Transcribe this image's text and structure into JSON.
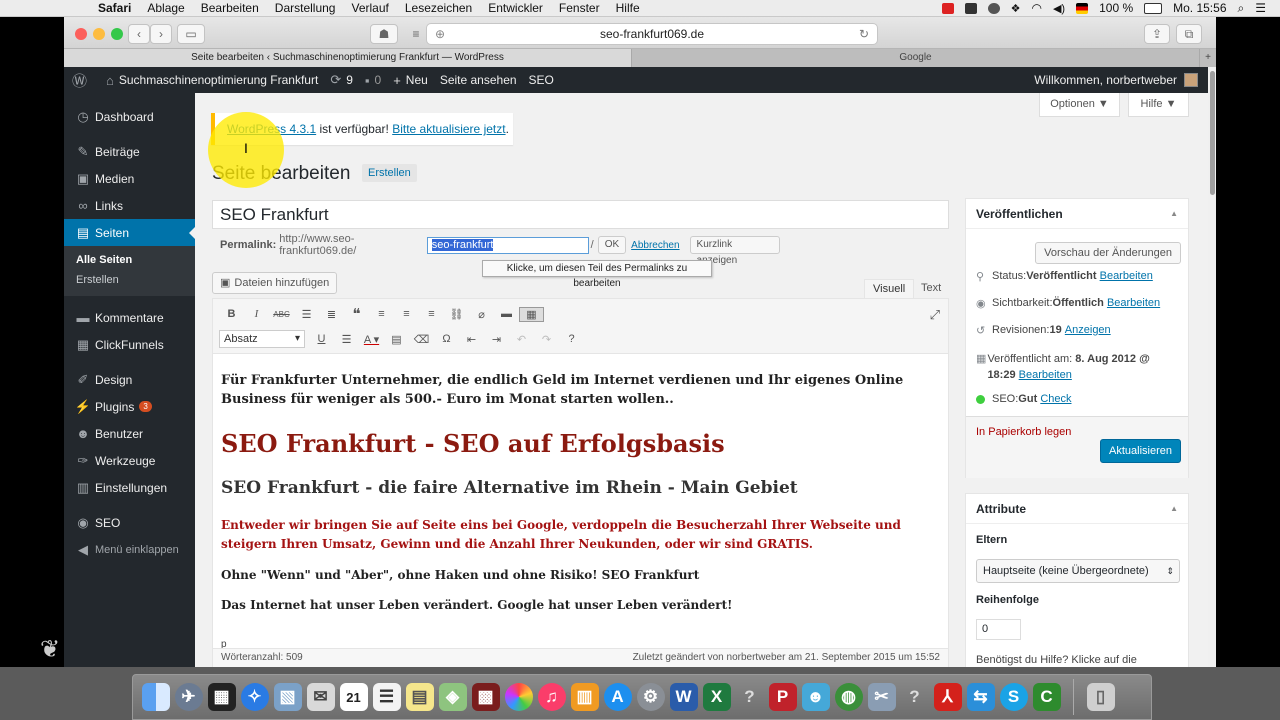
{
  "menubar": {
    "items": [
      "Safari",
      "Ablage",
      "Bearbeiten",
      "Darstellung",
      "Verlauf",
      "Lesezeichen",
      "Entwickler",
      "Fenster",
      "Hilfe"
    ],
    "battery": "100 %",
    "clock": "Mo. 15:56"
  },
  "safari": {
    "url": "seo-frankfurt069.de",
    "tabs": [
      "Seite bearbeiten ‹ Suchmaschinenoptimierung Frankfurt — WordPress",
      "Google"
    ]
  },
  "adminbar": {
    "site_name": "Suchmaschinenoptimierung Frankfurt",
    "updates_count": "9",
    "comments_count": "0",
    "new_label": "Neu",
    "view_page": "Seite ansehen",
    "seo": "SEO",
    "greeting": "Willkommen, norbertweber"
  },
  "sidebar": {
    "dashboard": "Dashboard",
    "beitraege": "Beiträge",
    "medien": "Medien",
    "links": "Links",
    "seiten": "Seiten",
    "sub_all": "Alle Seiten",
    "sub_new": "Erstellen",
    "kommentare": "Kommentare",
    "clickfunnels": "ClickFunnels",
    "design": "Design",
    "plugins": "Plugins",
    "plugins_badge": "3",
    "benutzer": "Benutzer",
    "werkzeuge": "Werkzeuge",
    "einstellungen": "Einstellungen",
    "seo": "SEO",
    "collapse": "Menü einklappen"
  },
  "screen": {
    "options": "Optionen ▼",
    "help": "Hilfe ▼"
  },
  "notice": {
    "link1": "WordPress 4.3.1",
    "middle": " ist verfügbar! ",
    "link2": "Bitte aktualisiere jetzt",
    "end": "."
  },
  "page": {
    "heading": "Seite bearbeiten",
    "add_new": "Erstellen",
    "title_value": "SEO Frankfurt",
    "permalink_label": "Permalink:",
    "permalink_base": "http://www.seo-frankfurt069.de/",
    "slug_value": "seo-frankfurt",
    "slug_trailing": "/",
    "ok": "OK",
    "cancel": "Abbrechen",
    "shortlink": "Kurzlink anzeigen",
    "tooltip": "Klicke, um diesen Teil des Permalinks zu bearbeiten"
  },
  "editor": {
    "add_media": "Dateien hinzufügen",
    "tab_visual": "Visuell",
    "tab_text": "Text",
    "format": "Absatz",
    "p1": "Für Frankfurter Unternehmer, die endlich Geld im Internet verdienen und Ihr eigenes Online Business für weniger als 500.- Euro im Monat starten wollen..",
    "h1": "SEO Frankfurt - SEO auf Erfolgsbasis",
    "h2": "SEO Frankfurt - die faire Alternative im Rhein - Main Gebiet",
    "red": "Entweder wir bringen Sie auf Seite eins bei Google, verdoppeln die Besucherzahl Ihrer Webseite und steigern Ihren Umsatz, Gewinn und die Anzahl Ihrer Neukunden, oder wir sind GRATIS.",
    "p2": "Ohne \"Wenn\" und \"Aber\", ohne Haken und ohne Risiko! SEO Frankfurt",
    "p3": "Das Internet hat unser Leben verändert. Google hat unser Leben verändert!",
    "path": "p",
    "word_count": "Wörteranzahl: 509",
    "last_edit": "Zuletzt geändert von norbertweber am 21. September 2015 um 15:52"
  },
  "publish": {
    "title": "Veröffentlichen",
    "preview": "Vorschau der Änderungen",
    "status_label": "Status: ",
    "status_value": "Veröffentlicht",
    "edit": "Bearbeiten",
    "visibility_label": "Sichtbarkeit: ",
    "visibility_value": "Öffentlich",
    "revisions_label": "Revisionen: ",
    "revisions_value": "19",
    "revisions_link": "Anzeigen",
    "published_label": "Veröffentlicht am: ",
    "published_value": "8. Aug 2012 @ 18:29",
    "seo_label": "SEO: ",
    "seo_value": "Gut",
    "seo_check": "Check",
    "trash": "In Papierkorb legen",
    "update": "Aktualisieren"
  },
  "attributes": {
    "title": "Attribute",
    "parent_label": "Eltern",
    "parent_value": "Hauptseite (keine Übergeordnete)",
    "order_label": "Reihenfolge",
    "order_value": "0",
    "help": "Benötigst du Hilfe? Klicke auf die"
  },
  "dock": {
    "calendar_day": "21"
  }
}
